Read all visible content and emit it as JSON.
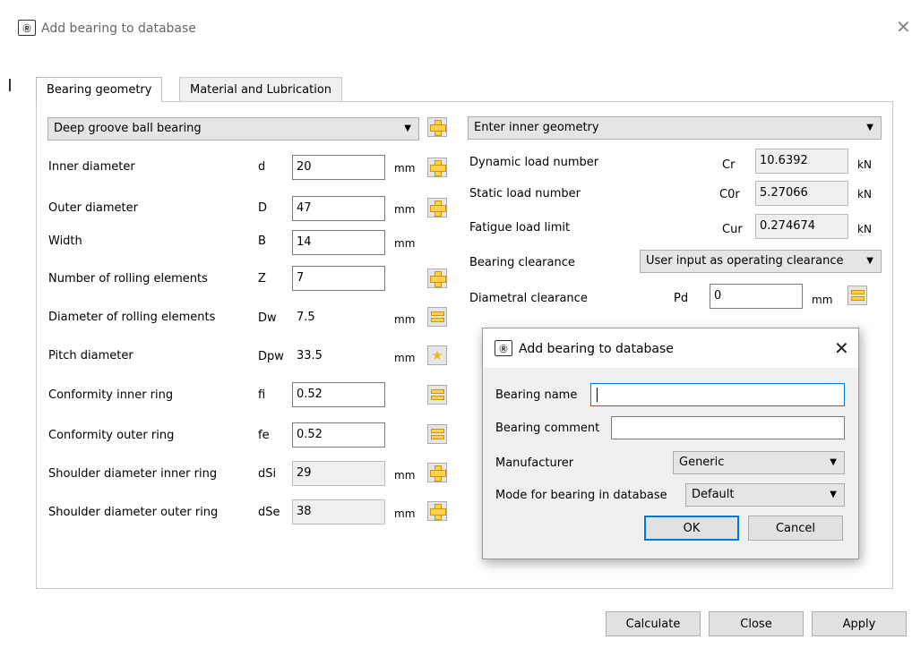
{
  "window": {
    "title": "Add bearing to database",
    "icon": "bearing-app-icon",
    "close_glyph": "✕"
  },
  "tabs": [
    {
      "label": "Bearing geometry",
      "active": true
    },
    {
      "label": "Material and Lubrication",
      "active": false
    }
  ],
  "geometry": {
    "bearing_type": "Deep groove ball bearing",
    "rows": [
      {
        "label": "Inner diameter",
        "symbol": "d",
        "value": "20",
        "unit": "mm",
        "icon": "plus-icon"
      },
      {
        "label": "Outer diameter",
        "symbol": "D",
        "value": "47",
        "unit": "mm",
        "icon": "plus-icon"
      },
      {
        "label": "Width",
        "symbol": "B",
        "value": "14",
        "unit": "mm",
        "icon": ""
      },
      {
        "label": "Number of rolling elements",
        "symbol": "Z",
        "value": "7",
        "unit": "",
        "icon": "plus-icon"
      },
      {
        "label": "Diameter of rolling elements",
        "symbol": "Dw",
        "value": "7.5",
        "unit": "mm",
        "icon": "equal-icon"
      },
      {
        "label": "Pitch diameter",
        "symbol": "Dpw",
        "value": "33.5",
        "unit": "mm",
        "icon": "star-icon"
      },
      {
        "label": "Conformity inner ring",
        "symbol": "fi",
        "value": "0.52",
        "unit": "",
        "icon": "equal-icon"
      },
      {
        "label": "Conformity outer ring",
        "symbol": "fe",
        "value": "0.52",
        "unit": "",
        "icon": "equal-icon"
      },
      {
        "label": "Shoulder diameter inner ring",
        "symbol": "dSi",
        "value": "29",
        "unit": "mm",
        "icon": "plus-icon"
      },
      {
        "label": "Shoulder diameter outer ring",
        "symbol": "dSe",
        "value": "38",
        "unit": "mm",
        "icon": "plus-icon"
      }
    ]
  },
  "loads": {
    "mode": "Enter inner geometry",
    "rows": [
      {
        "label": "Dynamic load number",
        "symbol": "Cr",
        "value": "10.6392",
        "unit": "kN"
      },
      {
        "label": "Static load number",
        "symbol": "C0r",
        "value": "5.27066",
        "unit": "kN"
      },
      {
        "label": "Fatigue load limit",
        "symbol": "Cur",
        "value": "0.274674",
        "unit": "kN"
      }
    ],
    "clearance_label": "Bearing clearance",
    "clearance_value": "User input as operating clearance",
    "diametral_label": "Diametral clearance",
    "diametral_symbol": "Pd",
    "diametral_value": "0",
    "diametral_unit": "mm"
  },
  "footer": {
    "calculate": "Calculate",
    "close": "Close",
    "apply": "Apply"
  },
  "popup": {
    "title": "Add bearing to database",
    "close_glyph": "✕",
    "name_label": "Bearing name",
    "name_value": "",
    "comment_label": "Bearing comment",
    "comment_value": "",
    "manufacturer_label": "Manufacturer",
    "manufacturer_value": "Generic",
    "mode_label": "Mode for bearing in database",
    "mode_value": "Default",
    "ok": "OK",
    "cancel": "Cancel"
  },
  "colors": {
    "accent": "#0078d7",
    "icon_yellow": "#ffd24a"
  }
}
